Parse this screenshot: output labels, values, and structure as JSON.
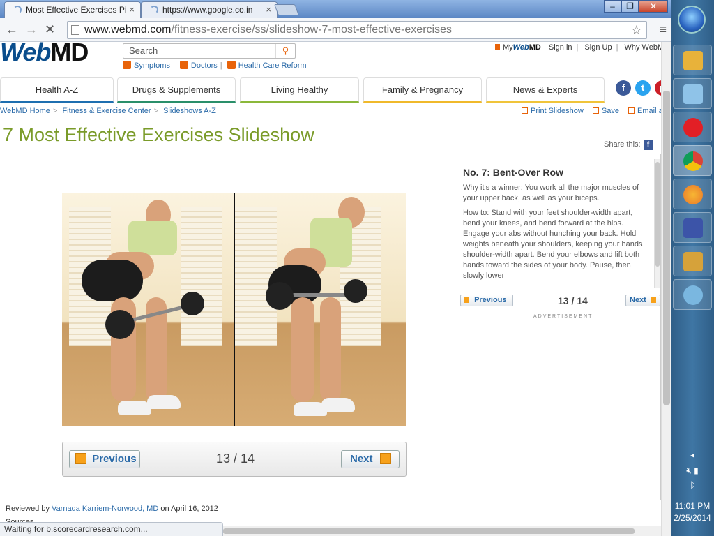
{
  "browser": {
    "tabs": [
      {
        "title": "Most Effective Exercises Pi",
        "active": true
      },
      {
        "title": "https://www.google.co.in",
        "active": false
      }
    ],
    "window_controls": [
      "–",
      "❐",
      "✕"
    ],
    "url_host": "www.webmd.com",
    "url_path": "/fitness-exercise/ss/slideshow-7-most-effective-exercises",
    "status_text": "Waiting for b.scorecardresearch.com..."
  },
  "header": {
    "logo_web": "Web",
    "logo_md": "MD",
    "search_placeholder": "Search",
    "quick_links": [
      "Symptoms",
      "Doctors",
      "Health Care Reform"
    ],
    "my_label": "My",
    "my_brand_web": "Web",
    "my_brand_md": "MD",
    "sign_in": "Sign in",
    "sign_up": "Sign Up",
    "why": "Why WebM"
  },
  "nav": {
    "tabs": [
      {
        "label": "Health A-Z",
        "color": "#1e6fb0"
      },
      {
        "label": "Drugs & Supplements",
        "color": "#2a8f6a"
      },
      {
        "label": "Living Healthy",
        "color": "#8bb83a"
      },
      {
        "label": "Family & Pregnancy",
        "color": "#f0b92b"
      },
      {
        "label": "News & Experts",
        "color": "#f0c43a"
      }
    ],
    "social": [
      {
        "label": "f",
        "color": "#3b5998"
      },
      {
        "label": "t",
        "color": "#2aa3ef"
      },
      {
        "label": "p",
        "color": "#cc1f27"
      }
    ]
  },
  "breadcrumb": [
    "WebMD Home",
    "Fitness & Exercise Center",
    "Slideshows A-Z"
  ],
  "tools": [
    "Print Slideshow",
    "Save",
    "Email a Fr"
  ],
  "page_title": "7 Most Effective Exercises Slideshow",
  "share_label": "Share this:",
  "share_fb": "f",
  "slide": {
    "pager": {
      "prev": "Previous",
      "next": "Next",
      "count": "13 / 14"
    },
    "title": "No. 7: Bent-Over Row",
    "paragraphs": [
      "Why it's a winner: You work all the major muscles of your upper back, as well as your biceps.",
      "How to: Stand with your feet shoulder-width apart, bend your knees, and bend forward at the hips. Engage your abs without hunching your back. Hold weights beneath your shoulders, keeping your hands shoulder-width apart. Bend your elbows and lift both hands toward the sides of your body. Pause, then slowly lower"
    ],
    "side_pager": {
      "prev": "Previous",
      "next": "Next",
      "count": "13 / 14"
    },
    "advertisement": "ADVERTISEMENT"
  },
  "review": {
    "prefix": "Reviewed by ",
    "reviewer": "Varnada Karriem-Norwood, MD",
    "suffix": " on April 16, 2012"
  },
  "sources_label": "Sources",
  "taskbar": {
    "apps": [
      {
        "name": "explorer",
        "color": "#e8b23a"
      },
      {
        "name": "notepad",
        "color": "#8fc3e8"
      },
      {
        "name": "airtel",
        "color": "#e21f26"
      },
      {
        "name": "chrome",
        "color": "#3ba047"
      },
      {
        "name": "firefox",
        "color": "#e8762b"
      },
      {
        "name": "screen-capture",
        "color": "#3c54a8"
      },
      {
        "name": "photo-viewer",
        "color": "#d6a23a"
      },
      {
        "name": "paint",
        "color": "#7ab7e0"
      }
    ],
    "time": "11:01 PM",
    "date": "2/25/2014"
  }
}
